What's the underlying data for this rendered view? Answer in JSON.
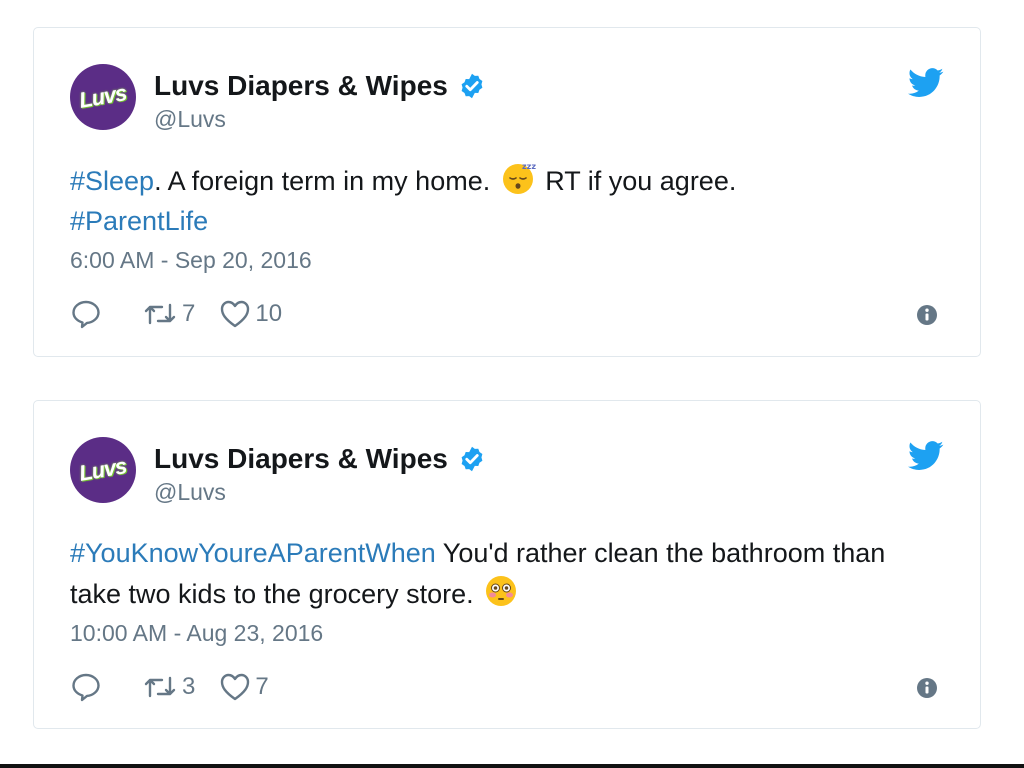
{
  "tweets": [
    {
      "author_name": "Luvs Diapers & Wipes",
      "handle": "@Luvs",
      "avatar_logo_text": "Luvs",
      "text": {
        "hashtag1": "#Sleep",
        "part1": ". A foreign term in my home. ",
        "emoji": "sleeping-face-emoji",
        "part2": " RT if you agree.",
        "hashtag2": "#ParentLife"
      },
      "timestamp": "6:00 AM - Sep 20, 2016",
      "retweets": "7",
      "likes": "10"
    },
    {
      "author_name": "Luvs Diapers & Wipes",
      "handle": "@Luvs",
      "avatar_logo_text": "Luvs",
      "text": {
        "hashtag1": "#YouKnowYoureAParentWhen",
        "part1": " You'd rather clean the bathroom than take two kids to the grocery store. ",
        "emoji": "flushed-face-emoji"
      },
      "timestamp": "10:00 AM - Aug 23, 2016",
      "retweets": "3",
      "likes": "7"
    }
  ],
  "colors": {
    "twitter_blue": "#1da1f2",
    "hashtag": "#2b7bb9",
    "secondary_text": "#657786",
    "avatar_bg": "#5b2d86"
  },
  "icons": [
    "twitter-bird-icon",
    "verified-badge-icon",
    "reply-icon",
    "retweet-icon",
    "heart-icon",
    "info-icon"
  ]
}
